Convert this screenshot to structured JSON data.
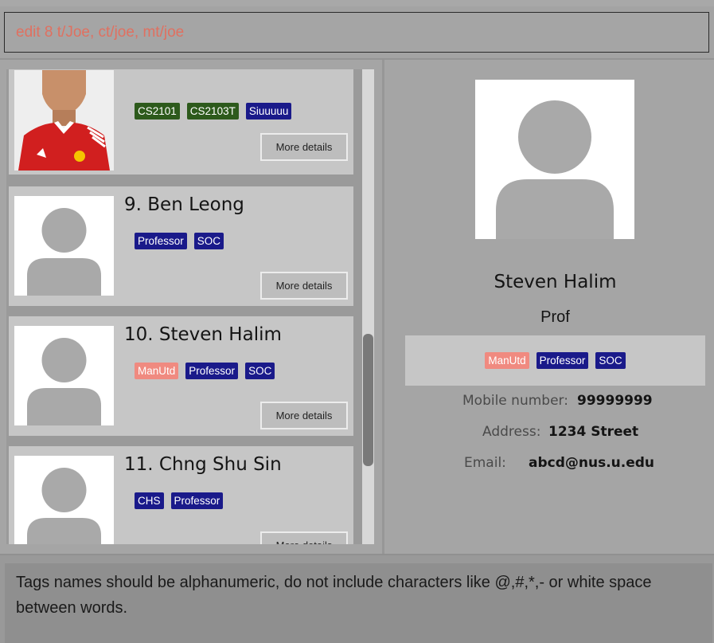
{
  "command_box": {
    "value": "edit 8 t/Joe, ct/joe, mt/joe"
  },
  "person_list": {
    "more_details_label": "More details",
    "cards": [
      {
        "index": "",
        "name": "",
        "photo": "photo",
        "tags": [
          {
            "label": "CS2101",
            "color": "#2d5a1c"
          },
          {
            "label": "CS2103T",
            "color": "#2d5a1c"
          },
          {
            "label": "Siuuuuu",
            "color": "#1a1a8a"
          }
        ]
      },
      {
        "index": "9.",
        "name": "Ben Leong",
        "photo": "avatar-placeholder",
        "tags": [
          {
            "label": "Professor",
            "color": "#1a1a8a"
          },
          {
            "label": "SOC",
            "color": "#1a1a8a"
          }
        ]
      },
      {
        "index": "10.",
        "name": "Steven Halim",
        "photo": "avatar-placeholder",
        "tags": [
          {
            "label": "ManUtd",
            "color": "#f08a80"
          },
          {
            "label": "Professor",
            "color": "#1a1a8a"
          },
          {
            "label": "SOC",
            "color": "#1a1a8a"
          }
        ]
      },
      {
        "index": "11.",
        "name": "Chng Shu Sin",
        "photo": "avatar-placeholder",
        "tags": [
          {
            "label": "CHS",
            "color": "#1a1a8a"
          },
          {
            "label": "Professor",
            "color": "#1a1a8a"
          }
        ]
      }
    ]
  },
  "detail_panel": {
    "name": "Steven Halim",
    "role": "Prof",
    "tags": [
      {
        "label": "ManUtd",
        "color": "#f08a80"
      },
      {
        "label": "Professor",
        "color": "#1a1a8a"
      },
      {
        "label": "SOC",
        "color": "#1a1a8a"
      }
    ],
    "mobile_label": "Mobile number:",
    "mobile_value": "99999999",
    "address_label": "Address:",
    "address_value": "1234 Street",
    "email_label": "Email:",
    "email_value": "abcd@nus.u.edu"
  },
  "result_display": {
    "text": "Tags names should be alphanumeric, do not include characters like @,#,*,- or white space between words."
  },
  "colors": {
    "background": "#9e9e9e",
    "card": "#c6c6c6",
    "tag_navy": "#1a1a8a",
    "tag_green": "#2d5a1c",
    "tag_salmon": "#f08a80",
    "command_text": "#e07060"
  }
}
